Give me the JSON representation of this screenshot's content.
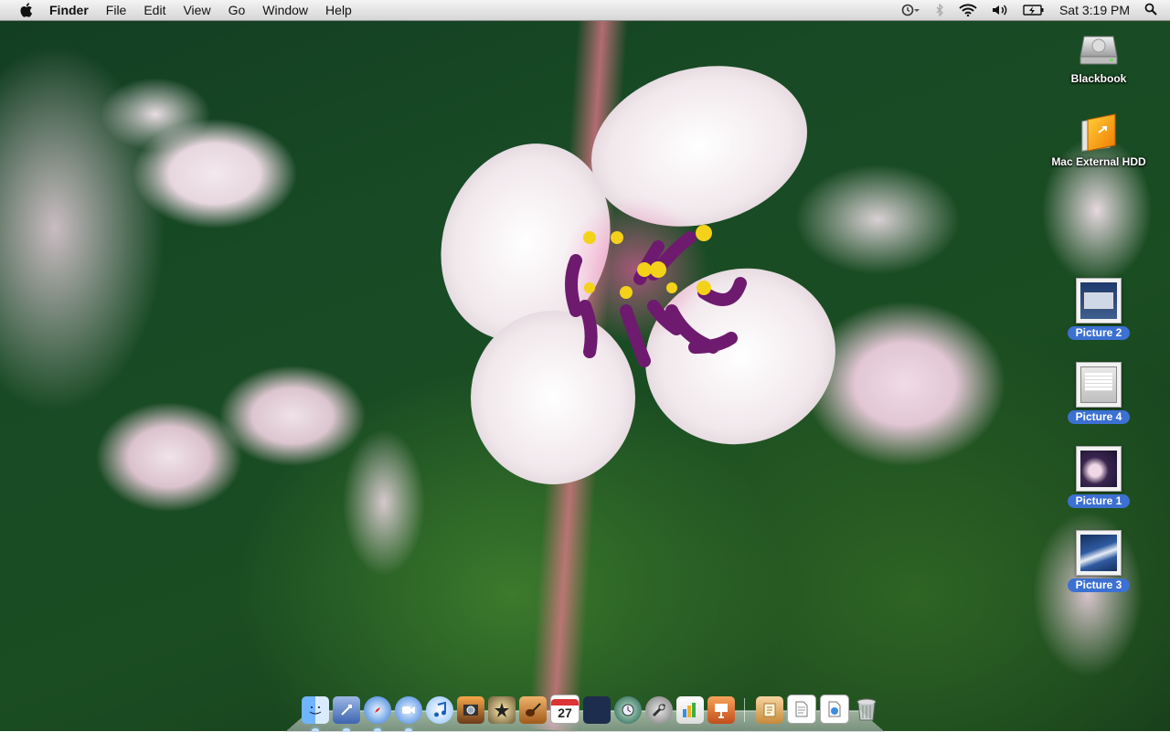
{
  "menubar": {
    "apple_icon": "apple-icon",
    "app_name": "Finder",
    "items": [
      "File",
      "Edit",
      "View",
      "Go",
      "Window",
      "Help"
    ],
    "status_icons": [
      "time-machine-icon",
      "bluetooth-icon",
      "wifi-icon",
      "volume-icon",
      "battery-icon"
    ],
    "clock": "Sat 3:19 PM",
    "spotlight_icon": "spotlight-icon"
  },
  "desktop": {
    "drives": [
      {
        "label": "Blackbook",
        "icon": "hard-drive-icon"
      },
      {
        "label": "Mac External HDD",
        "icon": "external-drive-icon"
      }
    ],
    "files": [
      {
        "label": "Picture 2",
        "selected": true
      },
      {
        "label": "Picture 4",
        "selected": true
      },
      {
        "label": "Picture 1",
        "selected": true
      },
      {
        "label": "Picture 3",
        "selected": true
      }
    ]
  },
  "dock": {
    "items": [
      {
        "name": "Finder",
        "icon": "finder-icon",
        "running": true
      },
      {
        "name": "Mail",
        "icon": "mail-icon",
        "running": true
      },
      {
        "name": "Safari",
        "icon": "safari-icon",
        "running": true
      },
      {
        "name": "iChat",
        "icon": "ichat-icon",
        "running": true
      },
      {
        "name": "iTunes",
        "icon": "itunes-icon",
        "running": false
      },
      {
        "name": "iPhoto",
        "icon": "iphoto-icon",
        "running": false
      },
      {
        "name": "iMovie",
        "icon": "imovie-icon",
        "running": false
      },
      {
        "name": "GarageBand",
        "icon": "garageband-icon",
        "running": false
      },
      {
        "name": "iCal",
        "icon": "ical-icon",
        "running": false,
        "badge": "27"
      },
      {
        "name": "Spaces",
        "icon": "spaces-icon",
        "running": false
      },
      {
        "name": "Time Machine",
        "icon": "time-machine-icon",
        "running": false
      },
      {
        "name": "System Preferences",
        "icon": "system-preferences-icon",
        "running": false
      },
      {
        "name": "Dashboard",
        "icon": "dashboard-icon",
        "running": false
      },
      {
        "name": "Keynote",
        "icon": "keynote-icon",
        "running": false
      },
      {
        "name": "Applications",
        "icon": "applications-stack-icon",
        "running": false
      },
      {
        "name": "Documents",
        "icon": "documents-stack-icon",
        "running": false
      },
      {
        "name": "Downloads",
        "icon": "downloads-stack-icon",
        "running": false
      },
      {
        "name": "Trash",
        "icon": "trash-icon",
        "running": false
      }
    ]
  },
  "colors": {
    "selection_label": "#3c70d2",
    "menubar_top": "#f4f4f4",
    "menubar_bottom": "#d6d6d6"
  }
}
